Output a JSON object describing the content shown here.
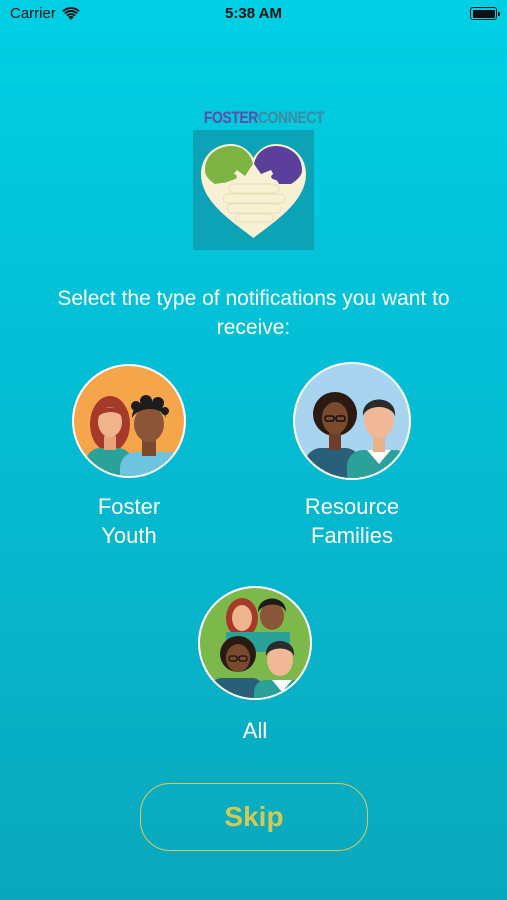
{
  "status_bar": {
    "carrier": "Carrier",
    "time": "5:38 AM"
  },
  "logo": {
    "text_part1": "FOSTER",
    "text_part2": "CONNECT"
  },
  "prompt": "Select the type of notifications you want to receive:",
  "options": [
    {
      "line1": "Foster",
      "line2": "Youth",
      "icon": "foster-youth-avatar"
    },
    {
      "line1": "Resource",
      "line2": "Families",
      "icon": "resource-families-avatar"
    },
    {
      "line1": "All",
      "icon": "all-group-avatar"
    }
  ],
  "skip_button": {
    "label": "Skip"
  },
  "colors": {
    "background_top": "#00cfe3",
    "background_bottom": "#0aa8bc",
    "skip_accent": "#d6c94f",
    "logo_purple": "#5b4ea8",
    "logo_green": "#7cb342"
  }
}
